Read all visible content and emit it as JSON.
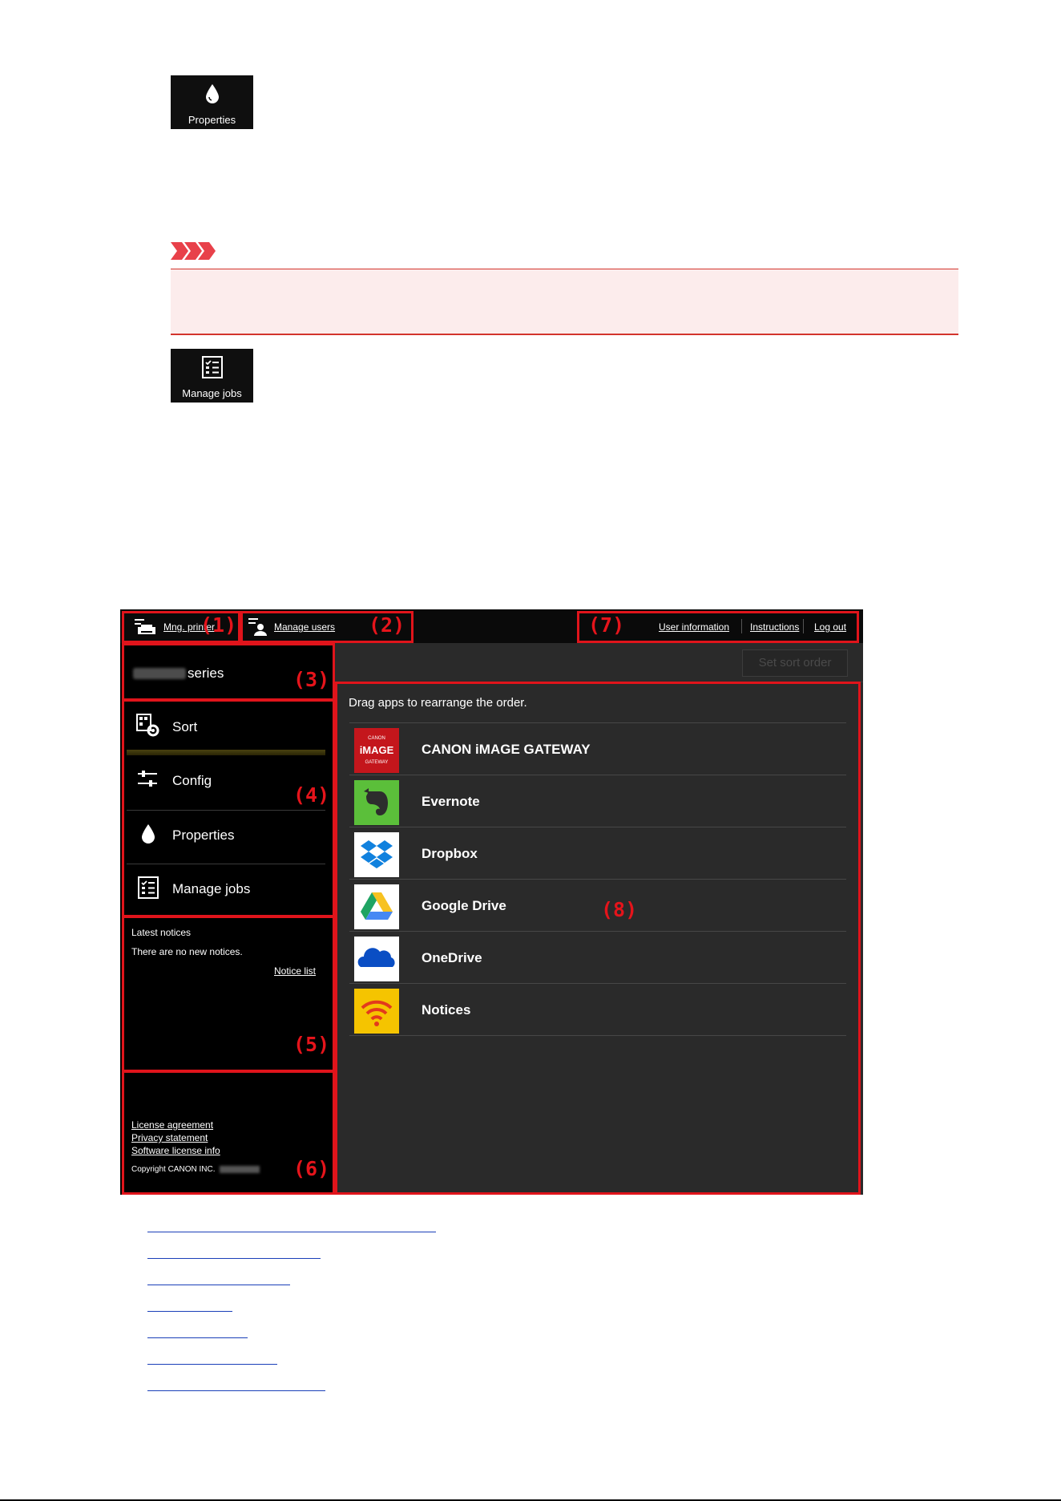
{
  "tiles": {
    "properties": "Properties",
    "manage_jobs": "Manage jobs"
  },
  "screen": {
    "topbar": {
      "mng_printer": "Mng. printer",
      "manage_users": "Manage users",
      "user_information": "User information",
      "instructions": "Instructions",
      "log_out": "Log out"
    },
    "printer_series": "series",
    "set_sort_order": "Set sort order",
    "menu": [
      {
        "label": "Sort",
        "icon": "sort-icon",
        "active": true
      },
      {
        "label": "Config",
        "icon": "config-icon"
      },
      {
        "label": "Properties",
        "icon": "ink-drop-icon"
      },
      {
        "label": "Manage jobs",
        "icon": "checklist-icon"
      }
    ],
    "notices": {
      "title": "Latest notices",
      "empty_text": "There are no new notices.",
      "list_link": "Notice list"
    },
    "footer": {
      "license": "License agreement",
      "privacy": "Privacy statement",
      "software_license": "Software license info",
      "copyright": "Copyright CANON INC."
    },
    "main": {
      "instruction": "Drag apps to rearrange the order.",
      "apps": [
        {
          "name": "CANON iMAGE GATEWAY",
          "icon": "canon-image-gateway-icon"
        },
        {
          "name": "Evernote",
          "icon": "evernote-icon"
        },
        {
          "name": "Dropbox",
          "icon": "dropbox-icon"
        },
        {
          "name": "Google Drive",
          "icon": "google-drive-icon"
        },
        {
          "name": "OneDrive",
          "icon": "onedrive-icon"
        },
        {
          "name": "Notices",
          "icon": "notices-icon"
        }
      ]
    },
    "callouts": [
      "(1)",
      "(2)",
      "(3)",
      "(4)",
      "(5)",
      "(6)",
      "(7)",
      "(8)"
    ]
  },
  "colors": {
    "callout_red": "#e0141b",
    "important_bg": "#fcecec",
    "link_blue": "#1a3fb8",
    "panel_dark": "#2a2a2a"
  }
}
